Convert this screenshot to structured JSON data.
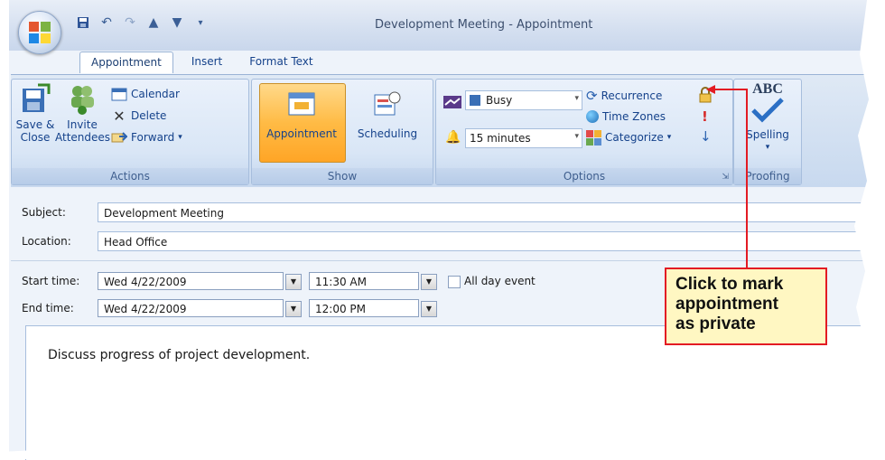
{
  "window": {
    "title": "Development Meeting - Appointment"
  },
  "tabs": [
    {
      "label": "Appointment"
    },
    {
      "label": "Insert"
    },
    {
      "label": "Format Text"
    }
  ],
  "ribbon": {
    "actions": {
      "group_label": "Actions",
      "save_close_line1": "Save &",
      "save_close_line2": "Close",
      "invite_line1": "Invite",
      "invite_line2": "Attendees",
      "calendar": "Calendar",
      "delete": "Delete",
      "forward": "Forward"
    },
    "show": {
      "group_label": "Show",
      "appointment": "Appointment",
      "scheduling": "Scheduling"
    },
    "options": {
      "group_label": "Options",
      "show_as": "Busy",
      "reminder": "15 minutes",
      "recurrence": "Recurrence",
      "time_zones": "Time Zones",
      "categorize": "Categorize"
    },
    "proofing": {
      "group_label": "Proofing",
      "spelling": "Spelling",
      "abc": "ABC"
    }
  },
  "form": {
    "subject_label": "Subject:",
    "subject_value": "Development Meeting",
    "location_label": "Location:",
    "location_value": "Head Office",
    "start_label": "Start time:",
    "start_date": "Wed 4/22/2009",
    "start_time": "11:30 AM",
    "all_day_label": "All day event",
    "end_label": "End time:",
    "end_date": "Wed 4/22/2009",
    "end_time": "12:00 PM",
    "body": "Discuss progress of project development."
  },
  "callout": {
    "line1": "Click to mark",
    "line2": "appointment",
    "line3": "as private"
  },
  "colors": {
    "callout_border": "#e31b23",
    "callout_fill": "#fff7c2",
    "active_button": "#ffbb45"
  }
}
